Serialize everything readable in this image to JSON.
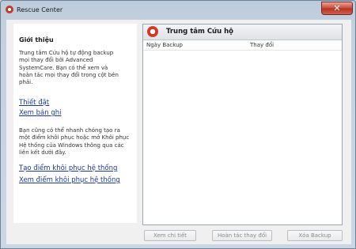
{
  "window": {
    "title": "Rescue Center",
    "close_label": "✕"
  },
  "intro": {
    "title": "Giới thiệu",
    "desc_lines": [
      "Trung tâm Cứu hộ tự động backup",
      "mọi thay đổi bởi Advanced",
      "SystemCare. Bạn có thể xem và",
      "hoàn tác mọi thay đổi trong cột bên",
      "phải."
    ],
    "link_settings": "Thiết đặt",
    "link_view_log": "Xem bản ghi",
    "restore_lines": [
      "Bạn cũng có thể nhanh chóng tạo ra",
      "một điểm khôi phục hoặc mở Khôi phục",
      "Hệ thống của Windows thông qua các",
      "liên kết dưới đây."
    ],
    "link_create_restore": "Tạo điểm khôi phục hệ thống",
    "link_view_restore": "Xem điểm khôi phục hệ thống"
  },
  "panel": {
    "title": "Trung tâm Cứu hộ",
    "columns": [
      "Ngày Backup",
      "Thay đổi"
    ],
    "rows": []
  },
  "buttons": {
    "details": "Xem chi tiết",
    "undo": "Hoàn tác thay đổi",
    "delete": "Xóa Backup"
  }
}
